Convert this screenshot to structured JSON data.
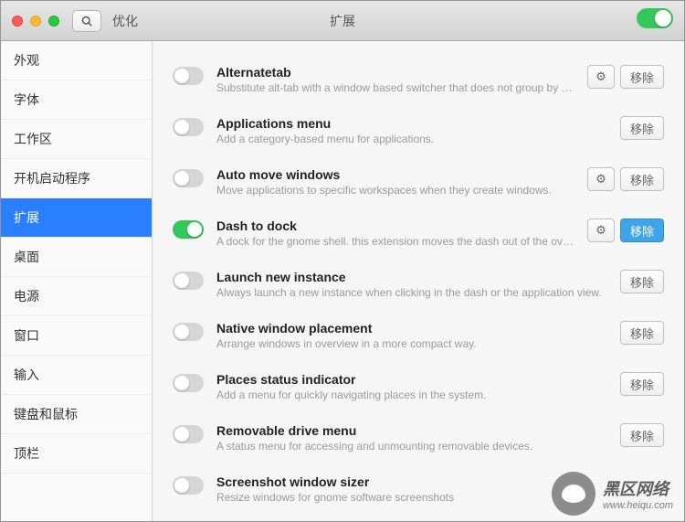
{
  "header": {
    "app_name": "优化",
    "title": "扩展",
    "master_on": true
  },
  "sidebar": {
    "items": [
      {
        "label": "外观"
      },
      {
        "label": "字体"
      },
      {
        "label": "工作区"
      },
      {
        "label": "开机启动程序"
      },
      {
        "label": "扩展",
        "active": true
      },
      {
        "label": "桌面"
      },
      {
        "label": "电源"
      },
      {
        "label": "窗口"
      },
      {
        "label": "输入"
      },
      {
        "label": "键盘和鼠标"
      },
      {
        "label": "顶栏"
      }
    ]
  },
  "actions": {
    "remove": "移除",
    "settings_icon": "⚙"
  },
  "extensions": [
    {
      "title": "Alternatetab",
      "desc": "Substitute alt-tab with a window based switcher that does not group by appli…",
      "on": false,
      "has_settings": true,
      "can_remove": true,
      "remove_primary": false
    },
    {
      "title": "Applications menu",
      "desc": "Add a category-based menu for applications.",
      "on": false,
      "has_settings": false,
      "can_remove": true,
      "remove_primary": false
    },
    {
      "title": "Auto move windows",
      "desc": "Move applications to specific workspaces when they create windows.",
      "on": false,
      "has_settings": true,
      "can_remove": true,
      "remove_primary": false
    },
    {
      "title": "Dash to dock",
      "desc": "A dock for the gnome shell. this extension moves the dash out of the overview t…",
      "on": true,
      "has_settings": true,
      "can_remove": true,
      "remove_primary": true
    },
    {
      "title": "Launch new instance",
      "desc": "Always launch a new instance when clicking in the dash or the application view.",
      "on": false,
      "has_settings": false,
      "can_remove": true,
      "remove_primary": false
    },
    {
      "title": "Native window placement",
      "desc": "Arrange windows in overview in a more compact way.",
      "on": false,
      "has_settings": false,
      "can_remove": true,
      "remove_primary": false
    },
    {
      "title": "Places status indicator",
      "desc": "Add a menu for quickly navigating places in the system.",
      "on": false,
      "has_settings": false,
      "can_remove": true,
      "remove_primary": false
    },
    {
      "title": "Removable drive menu",
      "desc": "A status menu for accessing and unmounting removable devices.",
      "on": false,
      "has_settings": false,
      "can_remove": true,
      "remove_primary": false
    },
    {
      "title": "Screenshot window sizer",
      "desc": "Resize windows for gnome software screenshots",
      "on": false,
      "has_settings": false,
      "can_remove": false,
      "remove_primary": false
    }
  ],
  "watermark": {
    "line1": "黑区网络",
    "line2": "www.heiqu.com"
  }
}
